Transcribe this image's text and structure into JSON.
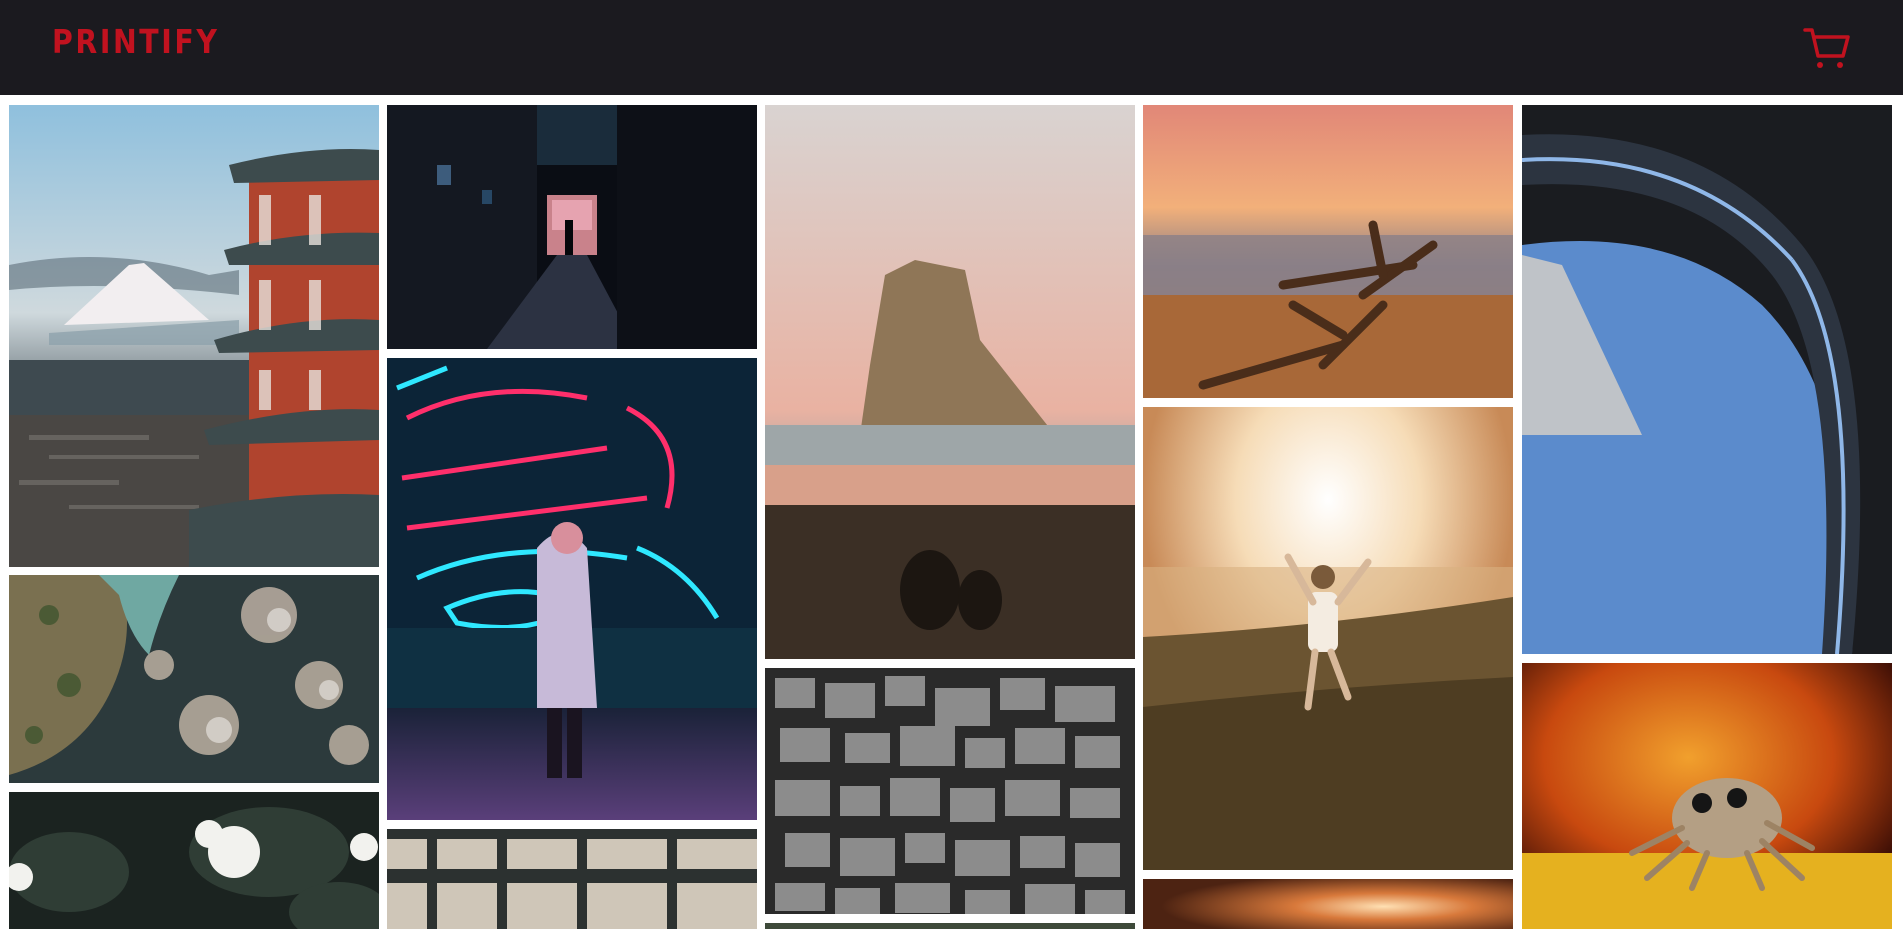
{
  "header": {
    "brand": "Printify",
    "cart_icon": "cart-icon",
    "colors": {
      "bar": "#1b1a1f",
      "brand": "#c1121f"
    }
  },
  "gallery": {
    "items": [
      {
        "id": "pagoda-fuji"
      },
      {
        "id": "alley-night"
      },
      {
        "id": "neon-whiskey-wall"
      },
      {
        "id": "rock-beach-sunset"
      },
      {
        "id": "driftwood-beach"
      },
      {
        "id": "curved-building"
      },
      {
        "id": "aerial-coast"
      },
      {
        "id": "white-roses"
      },
      {
        "id": "greenhouse-roof"
      },
      {
        "id": "camera-collection"
      },
      {
        "id": "child-sunset-field"
      },
      {
        "id": "jumping-spider"
      },
      {
        "id": "blurred-sunset"
      }
    ]
  }
}
